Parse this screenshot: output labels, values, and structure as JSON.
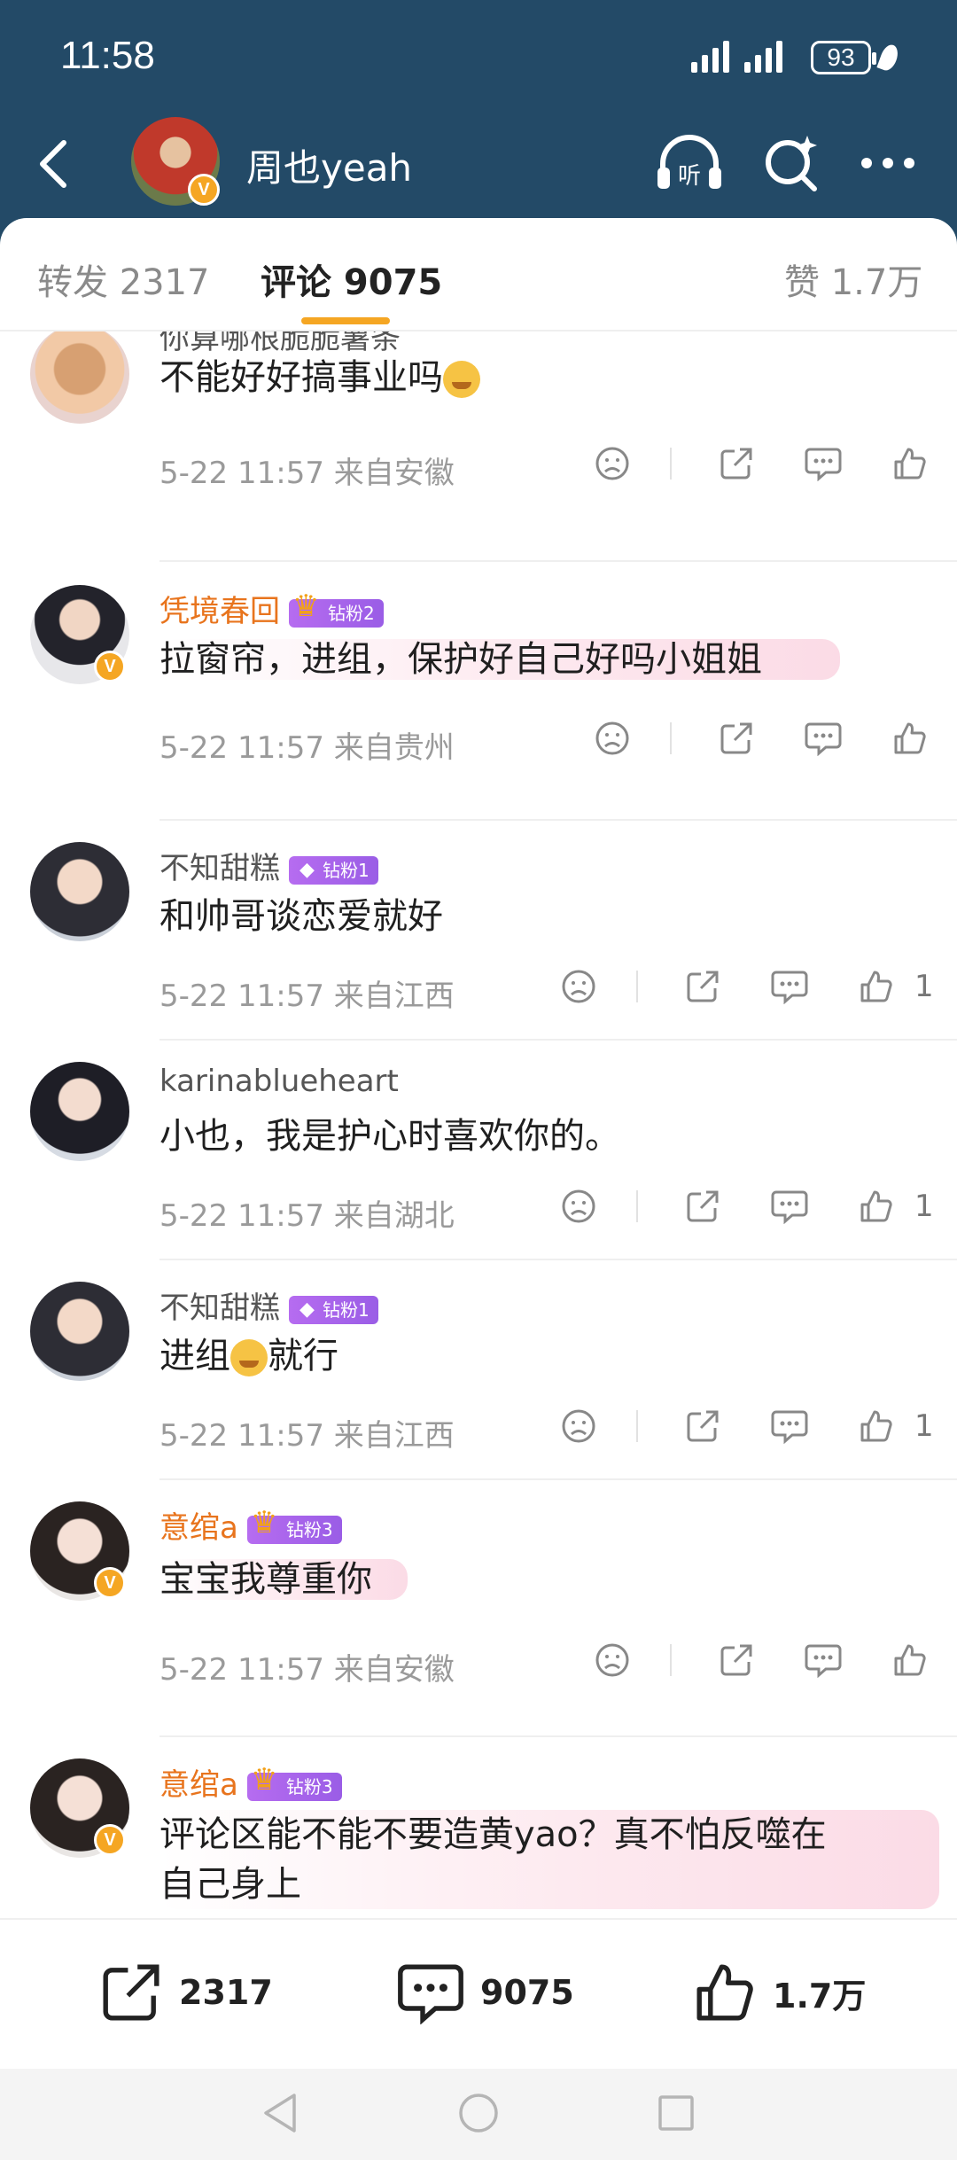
{
  "status": {
    "time": "11:58",
    "battery": "93"
  },
  "header": {
    "username": "周也yeah",
    "listen_label": "听"
  },
  "tabs": {
    "repost": "转发 2317",
    "comments": "评论 9075",
    "likes": "赞 1.7万"
  },
  "comments": [
    {
      "name": "你算哪根脆脆薯条",
      "text": "不能好好搞事业吗",
      "time": "5-22 11:57",
      "location": "来自安徽",
      "likes": "",
      "verified": false,
      "vip": false
    },
    {
      "name": "凭境春回",
      "fan_badge": "钻粉2",
      "text": "拉窗帘，进组，保护好自己好吗小姐姐",
      "time": "5-22 11:57",
      "location": "来自贵州",
      "likes": "",
      "verified": true,
      "vip": true
    },
    {
      "name": "不知甜糕",
      "fan_badge": "钻粉1",
      "text": "和帅哥谈恋爱就好",
      "time": "5-22 11:57",
      "location": "来自江西",
      "likes": "1",
      "verified": false,
      "vip": false
    },
    {
      "name": "karinablueheart",
      "text": "小也，我是护心时喜欢你的。",
      "time": "5-22 11:57",
      "location": "来自湖北",
      "likes": "1",
      "verified": false,
      "vip": false
    },
    {
      "name": "不知甜糕",
      "fan_badge": "钻粉1",
      "text_before": "进组",
      "text_after": "就行",
      "time": "5-22 11:57",
      "location": "来自江西",
      "likes": "1",
      "verified": false,
      "vip": false
    },
    {
      "name": "意绾a",
      "fan_badge": "钻粉3",
      "text": "宝宝我尊重你",
      "time": "5-22 11:57",
      "location": "来自安徽",
      "likes": "",
      "verified": true,
      "vip": true
    },
    {
      "name": "意绾a",
      "fan_badge": "钻粉3",
      "text_line1": "评论区能不能不要造黄yao？真不怕反噬在",
      "text_line2": "自己身上",
      "verified": true,
      "vip": true
    }
  ],
  "bottom_bar": {
    "repost": "2317",
    "comments": "9075",
    "likes": "1.7万"
  },
  "icons": {
    "back": "chevron-left-icon",
    "listen": "headphones-icon",
    "search": "search-sparkle-icon",
    "more": "more-dots-icon"
  },
  "colors": {
    "header_bg": "#234a67",
    "accent": "#f5a623",
    "vip_name": "#e8741d",
    "fan_badge": "#b66cf0"
  }
}
